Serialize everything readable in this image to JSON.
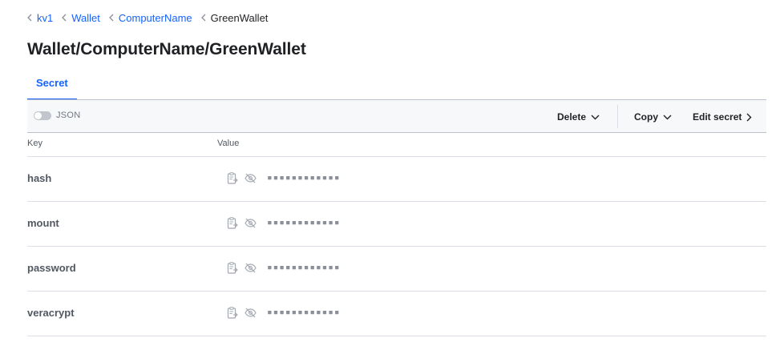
{
  "breadcrumb": [
    {
      "label": "kv1",
      "link": true
    },
    {
      "label": "Wallet",
      "link": true
    },
    {
      "label": "ComputerName",
      "link": true
    },
    {
      "label": "GreenWallet",
      "link": false
    }
  ],
  "page_title": "Wallet/ComputerName/GreenWallet",
  "tabs": [
    {
      "label": "Secret",
      "active": true
    }
  ],
  "toolbar": {
    "json_toggle_label": "JSON",
    "json_toggle_on": false,
    "delete_label": "Delete",
    "copy_label": "Copy",
    "edit_label": "Edit secret"
  },
  "table": {
    "headers": {
      "key": "Key",
      "value": "Value"
    },
    "rows": [
      {
        "key": "hash",
        "masked_value": "▪▪▪▪▪▪▪▪▪▪▪▪"
      },
      {
        "key": "mount",
        "masked_value": "▪▪▪▪▪▪▪▪▪▪▪▪"
      },
      {
        "key": "password",
        "masked_value": "▪▪▪▪▪▪▪▪▪▪▪▪"
      },
      {
        "key": "veracrypt",
        "masked_value": "▪▪▪▪▪▪▪▪▪▪▪▪"
      }
    ]
  },
  "colors": {
    "link": "#1563ff",
    "text": "#1f2124",
    "muted": "#525761",
    "border": "#dce0e6",
    "toolbar_bg": "#f7f8fa"
  },
  "icons": {
    "breadcrumb_separator": "chevron-left-icon",
    "copy_value": "clipboard-copy-icon",
    "reveal_value": "eye-off-icon",
    "delete_dropdown": "chevron-down-icon",
    "copy_dropdown": "chevron-down-icon",
    "edit": "chevron-right-icon"
  }
}
